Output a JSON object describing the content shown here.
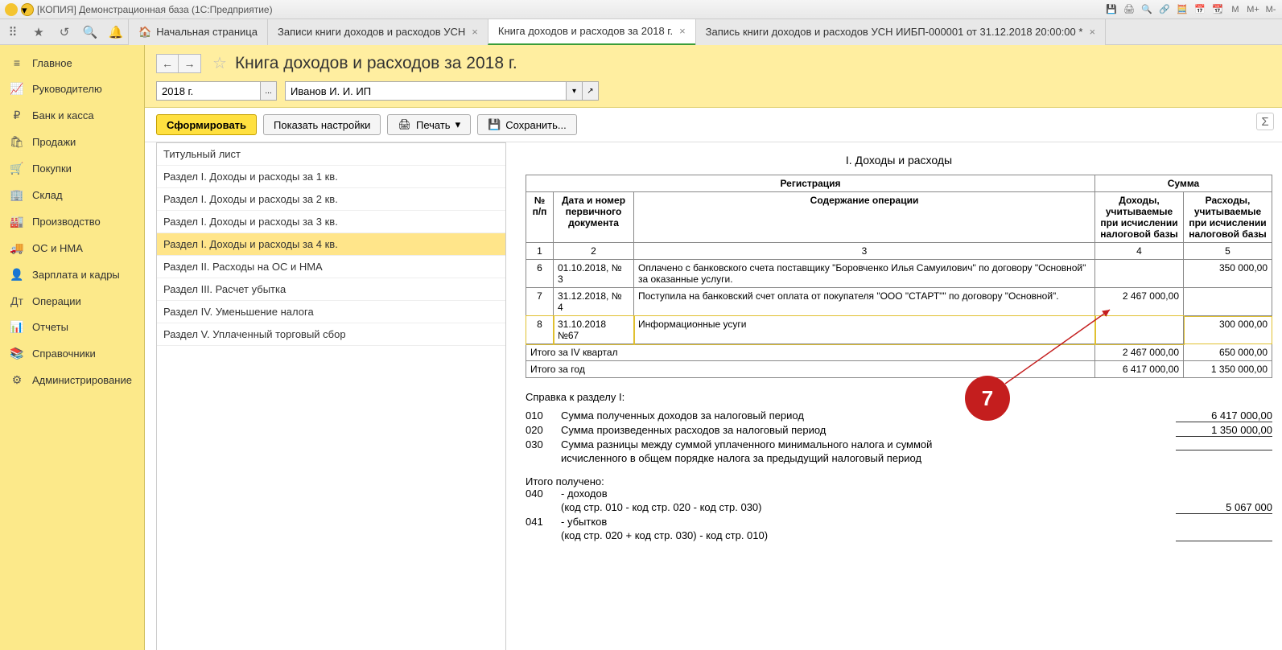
{
  "window_title": "[КОПИЯ] Демонстрационная база  (1С:Предприятие)",
  "toolbar_icons": [
    "M",
    "M+",
    "M-"
  ],
  "tabs": [
    {
      "label": "Начальная страница",
      "closable": false,
      "home": true
    },
    {
      "label": "Записи книги доходов и расходов УСН",
      "closable": true
    },
    {
      "label": "Книга доходов и расходов за 2018 г.",
      "closable": true,
      "active": true
    },
    {
      "label": "Запись книги доходов и расходов УСН ИИБП-000001 от 31.12.2018 20:00:00 *",
      "closable": true
    }
  ],
  "sidebar": [
    {
      "icon": "≡",
      "label": "Главное"
    },
    {
      "icon": "📈",
      "label": "Руководителю"
    },
    {
      "icon": "₽",
      "label": "Банк и касса"
    },
    {
      "icon": "🛍",
      "label": "Продажи"
    },
    {
      "icon": "🛒",
      "label": "Покупки"
    },
    {
      "icon": "🏢",
      "label": "Склад"
    },
    {
      "icon": "🏭",
      "label": "Производство"
    },
    {
      "icon": "🚚",
      "label": "ОС и НМА"
    },
    {
      "icon": "👤",
      "label": "Зарплата и кадры"
    },
    {
      "icon": "Дт",
      "label": "Операции"
    },
    {
      "icon": "📊",
      "label": "Отчеты"
    },
    {
      "icon": "📚",
      "label": "Справочники"
    },
    {
      "icon": "⚙",
      "label": "Администрирование"
    }
  ],
  "page_title": "Книга доходов и расходов за 2018 г.",
  "filters": {
    "period": "2018 г.",
    "org": "Иванов И. И. ИП"
  },
  "buttons": {
    "form": "Сформировать",
    "settings": "Показать настройки",
    "print": "Печать",
    "save": "Сохранить..."
  },
  "sections": [
    "Титульный лист",
    "Раздел I. Доходы и расходы за 1 кв.",
    "Раздел I. Доходы и расходы за 2 кв.",
    "Раздел I. Доходы и расходы за 3 кв.",
    "Раздел I. Доходы и расходы за 4 кв.",
    "Раздел II. Расходы на ОС и НМА",
    "Раздел III. Расчет убытка",
    "Раздел IV. Уменьшение налога",
    "Раздел V. Уплаченный торговый сбор"
  ],
  "section_selected": 4,
  "report": {
    "title": "I. Доходы и расходы",
    "headers": {
      "reg": "Регистрация",
      "sum": "Сумма",
      "num": "№ п/п",
      "doc": "Дата и номер первичного документа",
      "desc": "Содержание операции",
      "income": "Доходы, учитываемые при исчислении налоговой базы",
      "expense": "Расходы, учитываемые при исчислении налоговой базы",
      "c1": "1",
      "c2": "2",
      "c3": "3",
      "c4": "4",
      "c5": "5"
    },
    "rows": [
      {
        "n": "6",
        "doc": "01.10.2018, № 3",
        "desc": "Оплачено с банковского счета поставщику \"Боровченко Илья Самуилович\" по договору \"Основной\" за оказанные услуги.",
        "income": "",
        "expense": "350 000,00"
      },
      {
        "n": "7",
        "doc": "31.12.2018, № 4",
        "desc": "Поступила на банковский счет оплата от покупателя \"ООО \"СТАРТ\"\" по договору \"Основной\".",
        "income": "2 467 000,00",
        "expense": ""
      },
      {
        "n": "8",
        "doc": "31.10.2018 №67",
        "desc": "Информационные усуги",
        "income": "",
        "expense": "300 000,00",
        "hl": true
      }
    ],
    "totals": [
      {
        "label": "Итого за IV квартал",
        "income": "2 467 000,00",
        "expense": "650 000,00"
      },
      {
        "label": "Итого за год",
        "income": "6 417 000,00",
        "expense": "1 350 000,00"
      }
    ]
  },
  "spravka": {
    "title": "Справка к разделу I:",
    "lines": [
      {
        "code": "010",
        "txt": "Сумма полученных доходов за налоговый период",
        "val": "6 417 000,00"
      },
      {
        "code": "020",
        "txt": "Сумма произведенных  расходов за налоговый период",
        "val": "1 350 000,00"
      },
      {
        "code": "030",
        "txt": "Сумма разницы между  суммой уплаченного минимального налога и суммой",
        "val": ""
      },
      {
        "code": "",
        "txt": "исчисленного в общем порядке налога за предыдущий налоговый период",
        "val": "",
        "noval": true
      }
    ],
    "itogo": "Итого получено:",
    "lines2": [
      {
        "code": "040",
        "txt": "- доходов",
        "sub": "(код стр. 010 - код  стр. 020 - код стр. 030)",
        "val": "5 067 000"
      },
      {
        "code": "041",
        "txt": "- убытков",
        "sub": "(код стр. 020 + код  стр. 030) - код стр. 010)",
        "val": ""
      }
    ]
  },
  "badge": "7"
}
